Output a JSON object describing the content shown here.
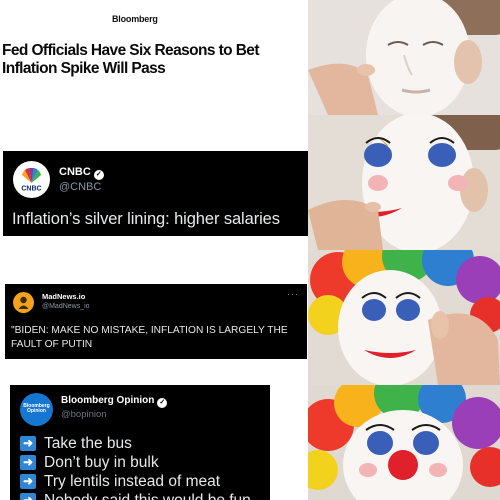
{
  "panel1": {
    "brand": "Bloomberg",
    "headline": "Fed Officials Have Six Reasons to Bet Inflation Spike Will Pass"
  },
  "panel2": {
    "avatar_text": "CNBC",
    "name": "CNBC",
    "handle": "@CNBC",
    "text": "Inflation’s silver lining: higher salaries"
  },
  "panel3": {
    "name": "MadNews.io",
    "handle": "@MadNews_io",
    "menu": "···",
    "text": "\"BIDEN: MAKE NO MISTAKE, INFLATION IS LARGELY THE FAULT OF PUTIN"
  },
  "panel4": {
    "avatar_text": "Bloomberg Opinion",
    "name": "Bloomberg Opinion",
    "handle": "@bopinion",
    "items": [
      "Take the bus",
      "Don’t buy in bulk",
      "Try lentils instead of meat",
      "Nobody said this would be fun"
    ],
    "arrow_icon": "right-arrow-icon"
  },
  "colors": {
    "tweet_bg": "#000000",
    "arrow_box": "#2f86d4",
    "clown_red": "#e0202a",
    "clown_blue": "#3a5fb8"
  }
}
